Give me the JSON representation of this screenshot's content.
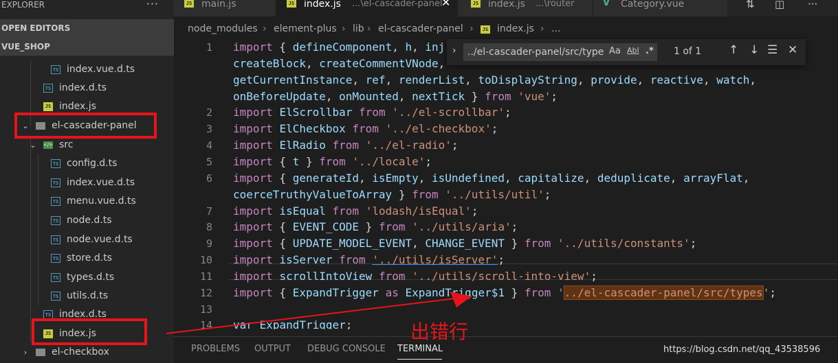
{
  "sidebar": {
    "title": "EXPLORER",
    "more": "···",
    "sections": {
      "open_editors": "OPEN EDITORS",
      "project": "VUE_SHOP"
    },
    "tree": [
      {
        "label": "index.vue.d.ts",
        "kind": "ts"
      },
      {
        "label": "index.d.ts",
        "kind": "ts"
      },
      {
        "label": "index.js",
        "kind": "js"
      },
      {
        "label": "el-cascader-panel",
        "kind": "folder",
        "chevron": "⌄"
      },
      {
        "label": "src",
        "kind": "src",
        "chevron": "⌄"
      },
      {
        "label": "config.d.ts",
        "kind": "ts"
      },
      {
        "label": "index.vue.d.ts",
        "kind": "ts"
      },
      {
        "label": "menu.vue.d.ts",
        "kind": "ts"
      },
      {
        "label": "node.d.ts",
        "kind": "ts"
      },
      {
        "label": "node.vue.d.ts",
        "kind": "ts"
      },
      {
        "label": "store.d.ts",
        "kind": "ts"
      },
      {
        "label": "types.d.ts",
        "kind": "ts"
      },
      {
        "label": "utils.d.ts",
        "kind": "ts"
      },
      {
        "label": "index.d.ts",
        "kind": "ts"
      },
      {
        "label": "index.js",
        "kind": "js"
      },
      {
        "label": "el-checkbox",
        "kind": "folder",
        "chevron": "›"
      }
    ]
  },
  "tabs": [
    {
      "label": "main.js",
      "desc": ""
    },
    {
      "label": "index.js",
      "desc": "...\\el-cascader-panel",
      "active": true
    },
    {
      "label": "index.js",
      "desc": "...\\router"
    },
    {
      "label": "Category.vue",
      "desc": ""
    }
  ],
  "breadcrumb": [
    "node_modules",
    "element-plus",
    "lib",
    "el-cascader-panel",
    "index.js",
    "..."
  ],
  "find_widget": {
    "query": "../el-cascader-panel/src/type",
    "match_case": "Aa",
    "whole_word": "Abl",
    "regex": ".*",
    "count": "1 of 1"
  },
  "code": [
    {
      "num": "1",
      "tokens": [
        [
          "kw",
          "import"
        ],
        [
          "pl",
          " { "
        ],
        [
          "id",
          "defineComponent"
        ],
        [
          "pl",
          ", "
        ],
        [
          "id",
          "h"
        ],
        [
          "pl",
          ", "
        ],
        [
          "id",
          "inj"
        ]
      ]
    },
    {
      "num": "",
      "tokens": [
        [
          "id",
          "createBlock"
        ],
        [
          "pl",
          ", "
        ],
        [
          "id",
          "createCommentVNode"
        ],
        [
          "pl",
          ","
        ]
      ]
    },
    {
      "num": "",
      "tokens": [
        [
          "id",
          "getCurrentInstance"
        ],
        [
          "pl",
          ", "
        ],
        [
          "id",
          "ref"
        ],
        [
          "pl",
          ", "
        ],
        [
          "id",
          "renderList"
        ],
        [
          "pl",
          ", "
        ],
        [
          "id",
          "toDisplayString"
        ],
        [
          "pl",
          ", "
        ],
        [
          "id",
          "provide"
        ],
        [
          "pl",
          ", "
        ],
        [
          "id",
          "reactive"
        ],
        [
          "pl",
          ", "
        ],
        [
          "id",
          "watch"
        ],
        [
          "pl",
          ","
        ]
      ]
    },
    {
      "num": "",
      "tokens": [
        [
          "id",
          "onBeforeUpdate"
        ],
        [
          "pl",
          ", "
        ],
        [
          "id",
          "onMounted"
        ],
        [
          "pl",
          ", "
        ],
        [
          "id",
          "nextTick"
        ],
        [
          "pl",
          " } "
        ],
        [
          "kw",
          "from"
        ],
        [
          "pl",
          " "
        ],
        [
          "str",
          "'vue'"
        ],
        [
          "pl",
          ";"
        ]
      ]
    },
    {
      "num": "2",
      "tokens": [
        [
          "kw",
          "import"
        ],
        [
          "pl",
          " "
        ],
        [
          "id",
          "ElScrollbar"
        ],
        [
          "pl",
          " "
        ],
        [
          "kw",
          "from"
        ],
        [
          "pl",
          " "
        ],
        [
          "str",
          "'../el-scrollbar'"
        ],
        [
          "pl",
          ";"
        ]
      ]
    },
    {
      "num": "3",
      "tokens": [
        [
          "kw",
          "import"
        ],
        [
          "pl",
          " "
        ],
        [
          "id",
          "ElCheckbox"
        ],
        [
          "pl",
          " "
        ],
        [
          "kw",
          "from"
        ],
        [
          "pl",
          " "
        ],
        [
          "str",
          "'../el-checkbox'"
        ],
        [
          "pl",
          ";"
        ]
      ]
    },
    {
      "num": "4",
      "tokens": [
        [
          "kw",
          "import"
        ],
        [
          "pl",
          " "
        ],
        [
          "id",
          "ElRadio"
        ],
        [
          "pl",
          " "
        ],
        [
          "kw",
          "from"
        ],
        [
          "pl",
          " "
        ],
        [
          "str",
          "'../el-radio'"
        ],
        [
          "pl",
          ";"
        ]
      ]
    },
    {
      "num": "5",
      "tokens": [
        [
          "kw",
          "import"
        ],
        [
          "pl",
          " { "
        ],
        [
          "id",
          "t"
        ],
        [
          "pl",
          " } "
        ],
        [
          "kw",
          "from"
        ],
        [
          "pl",
          " "
        ],
        [
          "str",
          "'../locale'"
        ],
        [
          "pl",
          ";"
        ]
      ]
    },
    {
      "num": "6",
      "tokens": [
        [
          "kw",
          "import"
        ],
        [
          "pl",
          " { "
        ],
        [
          "id",
          "generateId"
        ],
        [
          "pl",
          ", "
        ],
        [
          "id",
          "isEmpty"
        ],
        [
          "pl",
          ", "
        ],
        [
          "id",
          "isUndefined"
        ],
        [
          "pl",
          ", "
        ],
        [
          "id",
          "capitalize"
        ],
        [
          "pl",
          ", "
        ],
        [
          "id",
          "deduplicate"
        ],
        [
          "pl",
          ", "
        ],
        [
          "id",
          "arrayFlat"
        ],
        [
          "pl",
          ","
        ]
      ]
    },
    {
      "num": "",
      "tokens": [
        [
          "id",
          "coerceTruthyValueToArray"
        ],
        [
          "pl",
          " } "
        ],
        [
          "kw",
          "from"
        ],
        [
          "pl",
          " "
        ],
        [
          "str",
          "'../utils/util'"
        ],
        [
          "pl",
          ";"
        ]
      ]
    },
    {
      "num": "7",
      "tokens": [
        [
          "kw",
          "import"
        ],
        [
          "pl",
          " "
        ],
        [
          "id",
          "isEqual"
        ],
        [
          "pl",
          " "
        ],
        [
          "kw",
          "from"
        ],
        [
          "pl",
          " "
        ],
        [
          "str",
          "'lodash/isEqual'"
        ],
        [
          "pl",
          ";"
        ]
      ]
    },
    {
      "num": "8",
      "tokens": [
        [
          "kw",
          "import"
        ],
        [
          "pl",
          " { "
        ],
        [
          "id",
          "EVENT_CODE"
        ],
        [
          "pl",
          " } "
        ],
        [
          "kw",
          "from"
        ],
        [
          "pl",
          " "
        ],
        [
          "str",
          "'../utils/aria'"
        ],
        [
          "pl",
          ";"
        ]
      ]
    },
    {
      "num": "9",
      "tokens": [
        [
          "kw",
          "import"
        ],
        [
          "pl",
          " { "
        ],
        [
          "id",
          "UPDATE_MODEL_EVENT"
        ],
        [
          "pl",
          ", "
        ],
        [
          "id",
          "CHANGE_EVENT"
        ],
        [
          "pl",
          " } "
        ],
        [
          "kw",
          "from"
        ],
        [
          "pl",
          " "
        ],
        [
          "str",
          "'../utils/constants'"
        ],
        [
          "pl",
          ";"
        ]
      ]
    },
    {
      "num": "10",
      "tokens": [
        [
          "kw",
          "import"
        ],
        [
          "pl",
          " "
        ],
        [
          "id",
          "isServer"
        ],
        [
          "pl",
          " "
        ],
        [
          "kw",
          "from"
        ],
        [
          "pl",
          " "
        ],
        [
          "link",
          "'../utils/isServer'"
        ],
        [
          "pl",
          ";"
        ]
      ]
    },
    {
      "num": "11",
      "tokens": [
        [
          "kw",
          "import"
        ],
        [
          "pl",
          " "
        ],
        [
          "id",
          "scrollIntoView"
        ],
        [
          "pl",
          " "
        ],
        [
          "kw",
          "from"
        ],
        [
          "pl",
          " "
        ],
        [
          "str",
          "'../utils/scroll-into-view'"
        ],
        [
          "pl",
          ";"
        ]
      ]
    },
    {
      "num": "12",
      "tokens": [
        [
          "kw",
          "import"
        ],
        [
          "pl",
          " { "
        ],
        [
          "id",
          "ExpandTrigger"
        ],
        [
          "pl",
          " "
        ],
        [
          "kw",
          "as"
        ],
        [
          "pl",
          " "
        ],
        [
          "id",
          "ExpandTrigger$1"
        ],
        [
          "pl",
          " } "
        ],
        [
          "kw",
          "from"
        ],
        [
          "pl",
          " "
        ],
        [
          "str",
          "'"
        ],
        [
          "hl",
          "../el-cascader-panel/src/types"
        ],
        [
          "str",
          "'"
        ],
        [
          "pl",
          ";"
        ]
      ]
    },
    {
      "num": "13",
      "tokens": []
    },
    {
      "num": "14",
      "tokens": [
        [
          "id",
          "var"
        ],
        [
          "pl",
          " "
        ],
        [
          "id",
          "ExpandTrigger"
        ],
        [
          "pl",
          ";"
        ]
      ]
    }
  ],
  "panel": {
    "tabs": [
      "PROBLEMS",
      "OUTPUT",
      "DEBUG CONSOLE",
      "TERMINAL"
    ],
    "active": "TERMINAL",
    "watermark": "https://blog.csdn.net/qq_43538596"
  },
  "annotation": {
    "text": "出错行"
  },
  "colors": {
    "highlight_box": "#e8141b",
    "find_match": "#613214",
    "keyword": "#c586c0",
    "string": "#ce9178",
    "identifier": "#9cdcfe"
  }
}
